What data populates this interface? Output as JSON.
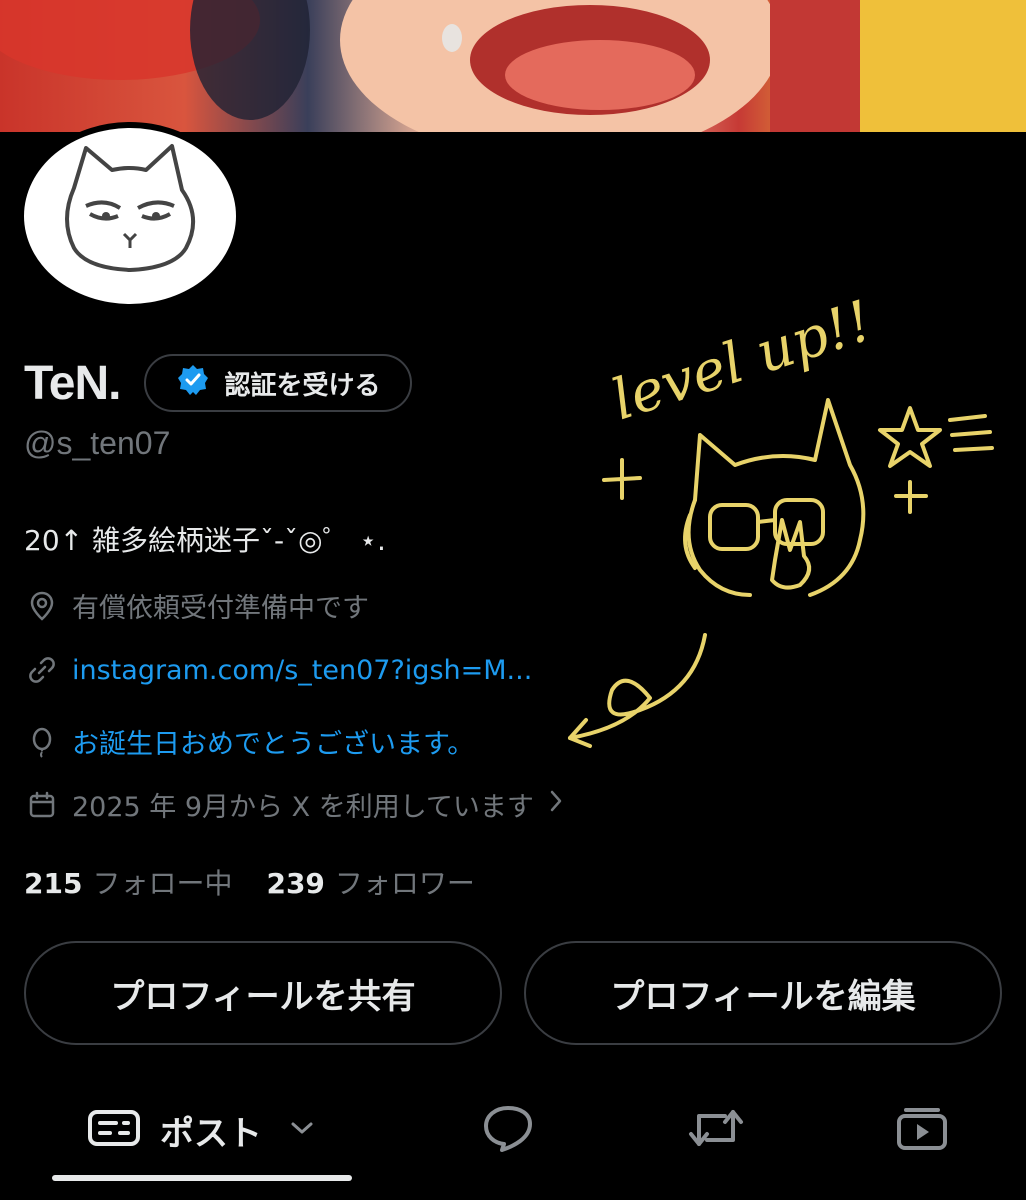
{
  "profile": {
    "name": "TeN.",
    "verify_label": "認証を受ける",
    "handle": "@s_ten07",
    "bio": "20↑ 雑多絵柄迷子ˇ-ˇ◎゜ ⋆.",
    "location": "有償依頼受付準備中です",
    "website": "instagram.com/s_ten07?igsh=M...",
    "birthday": "お誕生日おめでとうございます。",
    "joined": "2025 年 9月から X を利用しています",
    "following_count": "215",
    "following_label": "フォロー中",
    "followers_count": "239",
    "followers_label": "フォロワー"
  },
  "actions": {
    "share_label": "プロフィールを共有",
    "edit_label": "プロフィールを編集"
  },
  "tabs": {
    "posts_label": "ポスト"
  },
  "doodle": {
    "text": "level up!!"
  },
  "colors": {
    "link": "#1d9bf0",
    "muted": "#71767b",
    "doodle": "#e8d36a",
    "verified": "#1d9bf0"
  },
  "icons": [
    "verified-badge-icon",
    "location-pin-icon",
    "link-icon",
    "balloon-icon",
    "calendar-icon",
    "chevron-right-icon",
    "posts-icon",
    "chevron-down-icon",
    "reply-icon",
    "repost-icon",
    "video-icon"
  ]
}
